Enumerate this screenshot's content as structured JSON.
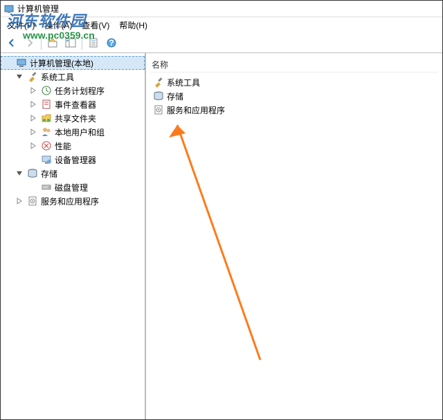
{
  "title": "计算机管理",
  "menubar": {
    "file": "文件",
    "file_key": "(F)",
    "action": "操作",
    "action_key": "(A)",
    "view": "查看",
    "view_key": "(V)",
    "help": "帮助",
    "help_key": "(H)"
  },
  "tree": {
    "root": "计算机管理(本地)",
    "system_tools": "系统工具",
    "task_scheduler": "任务计划程序",
    "event_viewer": "事件查看器",
    "shared_folders": "共享文件夹",
    "local_users": "本地用户和组",
    "performance": "性能",
    "device_manager": "设备管理器",
    "storage": "存储",
    "disk_management": "磁盘管理",
    "services_apps": "服务和应用程序"
  },
  "main": {
    "column_name": "名称",
    "items": {
      "system_tools": "系统工具",
      "storage": "存储",
      "services_apps": "服务和应用程序"
    }
  },
  "watermark": {
    "line1": "河东软件园",
    "line2": "www.pc0359.cn"
  }
}
